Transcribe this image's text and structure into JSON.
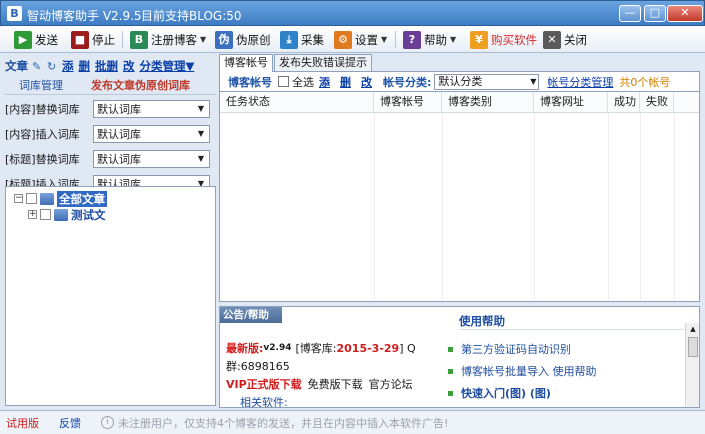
{
  "window": {
    "icon_letter": "B",
    "title": "智动博客助手 V2.9.5",
    "subtitle": "目前支持BLOG:50",
    "controls": {
      "minimize": "—",
      "maximize": "□",
      "close": "✕"
    }
  },
  "toolbar": {
    "items": [
      {
        "label": "发送",
        "icon": "play-icon",
        "color": "#2f9a38"
      },
      {
        "label": "停止",
        "icon": "stop-icon",
        "color": "#9b1c1c"
      },
      {
        "label": "注册博客",
        "icon": "blog-icon",
        "color": "#2a8a57",
        "has_menu": true
      },
      {
        "label": "伪原创",
        "icon": "spin-icon",
        "color": "#3b6fbf"
      },
      {
        "label": "采集",
        "icon": "collect-icon",
        "color": "#2d82c8"
      },
      {
        "label": "设置",
        "icon": "gear-icon",
        "color": "#e0791f",
        "has_menu": true
      },
      {
        "label": "帮助",
        "icon": "help-icon",
        "color": "#6a3e97",
        "has_menu": true
      },
      {
        "label": "购买软件",
        "icon": "cart-icon",
        "color": "#f0a020"
      },
      {
        "label": "关闭",
        "icon": "close-icon",
        "color": "#5a5a5a"
      }
    ]
  },
  "article_bar": {
    "label": "文章",
    "links": [
      "添",
      "删",
      "批删",
      "改",
      "分类管理▼"
    ]
  },
  "lib_tabs": {
    "left": "词库管理",
    "right": "发布文章伪原创词库"
  },
  "libraries": [
    {
      "label": "[内容]替换词库",
      "value": "默认词库"
    },
    {
      "label": "[内容]插入词库",
      "value": "默认词库"
    },
    {
      "label": "[标题]替换词库",
      "value": "默认词库"
    },
    {
      "label": "[标题]插入词库",
      "value": "默认词库"
    }
  ],
  "tree": {
    "root": "全部文章",
    "child": "测试文"
  },
  "right_tabs": [
    "博客帐号",
    "发布失败错误提示"
  ],
  "filter": {
    "header": "博客帐号",
    "select_all": "全选",
    "links": [
      "添",
      "删",
      "改"
    ],
    "category_label": "帐号分类:",
    "category_value": "默认分类",
    "manage_link": "帐号分类管理",
    "count": "共0个帐号"
  },
  "grid_columns": [
    "任务状态",
    "博客帐号",
    "博客类别",
    "博客网址",
    "成功",
    "失败"
  ],
  "help": {
    "tab": "公告/帮助",
    "latest_label": "最新版:",
    "latest_version": "v2.94",
    "blog_lib_label": "[博客库:",
    "blog_lib_date": "2015-3-29",
    "blog_lib_tail": "] Q",
    "group": "群:6898165",
    "vip": "VIP正式版下载",
    "free": "免费版下载",
    "forum": "官方论坛",
    "related": "相关软件:",
    "usage_title": "使用帮助",
    "usage_items": [
      "第三方验证码自动识别",
      "博客帐号批量导入 使用帮助",
      "快速入门(图) (图)"
    ]
  },
  "status": {
    "trial": "试用版",
    "feedback": "反馈",
    "info": "未注册用户，仅支持4个博客的发送，并且在内容中插入本软件广告!"
  }
}
